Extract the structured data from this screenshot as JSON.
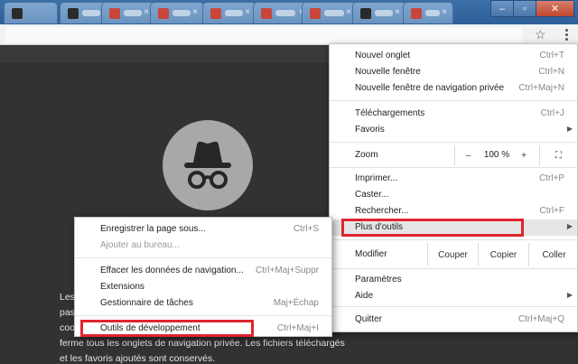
{
  "browser": {
    "tabs": [
      {
        "fav_color": "#2a2a2a"
      },
      {
        "fav_color": "#c8463a"
      },
      {
        "fav_color": "#c8463a"
      },
      {
        "fav_color": "#c8463a"
      },
      {
        "fav_color": "#c8463a"
      }
    ],
    "tab_close_glyph": "×",
    "window_controls": {
      "minimize": "–",
      "maximize": "▫",
      "close": "✕"
    },
    "star_glyph": "☆"
  },
  "incognito_page": {
    "lines": [
      "Les",
      "pas",
      "coo",
      "ferme tous les onglets de navigation privée. Les fichiers téléchargés",
      "et les favoris ajoutés sont conservés."
    ]
  },
  "main_menu": {
    "new_tab": {
      "label": "Nouvel onglet",
      "shortcut": "Ctrl+T"
    },
    "new_window": {
      "label": "Nouvelle fenêtre",
      "shortcut": "Ctrl+N"
    },
    "new_private": {
      "label": "Nouvelle fenêtre de navigation privée",
      "shortcut": "Ctrl+Maj+N"
    },
    "downloads": {
      "label": "Téléchargements",
      "shortcut": "Ctrl+J"
    },
    "bookmarks": {
      "label": "Favoris"
    },
    "zoom": {
      "label": "Zoom",
      "minus": "–",
      "value": "100 %",
      "plus": "+",
      "fullscreen": "⛶"
    },
    "print": {
      "label": "Imprimer...",
      "shortcut": "Ctrl+P"
    },
    "cast": {
      "label": "Caster..."
    },
    "find": {
      "label": "Rechercher...",
      "shortcut": "Ctrl+F"
    },
    "more_tools": {
      "label": "Plus d'outils"
    },
    "edit": {
      "label": "Modifier",
      "cut": "Couper",
      "copy": "Copier",
      "paste": "Coller"
    },
    "settings": {
      "label": "Paramètres"
    },
    "help": {
      "label": "Aide"
    },
    "quit": {
      "label": "Quitter",
      "shortcut": "Ctrl+Maj+Q"
    }
  },
  "sub_menu": {
    "save_page": {
      "label": "Enregistrer la page sous...",
      "shortcut": "Ctrl+S"
    },
    "add_desktop": {
      "label": "Ajouter au bureau..."
    },
    "clear_data": {
      "label": "Effacer les données de navigation...",
      "shortcut": "Ctrl+Maj+Suppr"
    },
    "extensions": {
      "label": "Extensions"
    },
    "task_manager": {
      "label": "Gestionnaire de tâches",
      "shortcut": "Maj+Échap"
    },
    "dev_tools": {
      "label": "Outils de développement",
      "shortcut": "Ctrl+Maj+I"
    }
  },
  "colors": {
    "highlight": "#e0252e",
    "incognito_bg": "#a8a8a8"
  }
}
